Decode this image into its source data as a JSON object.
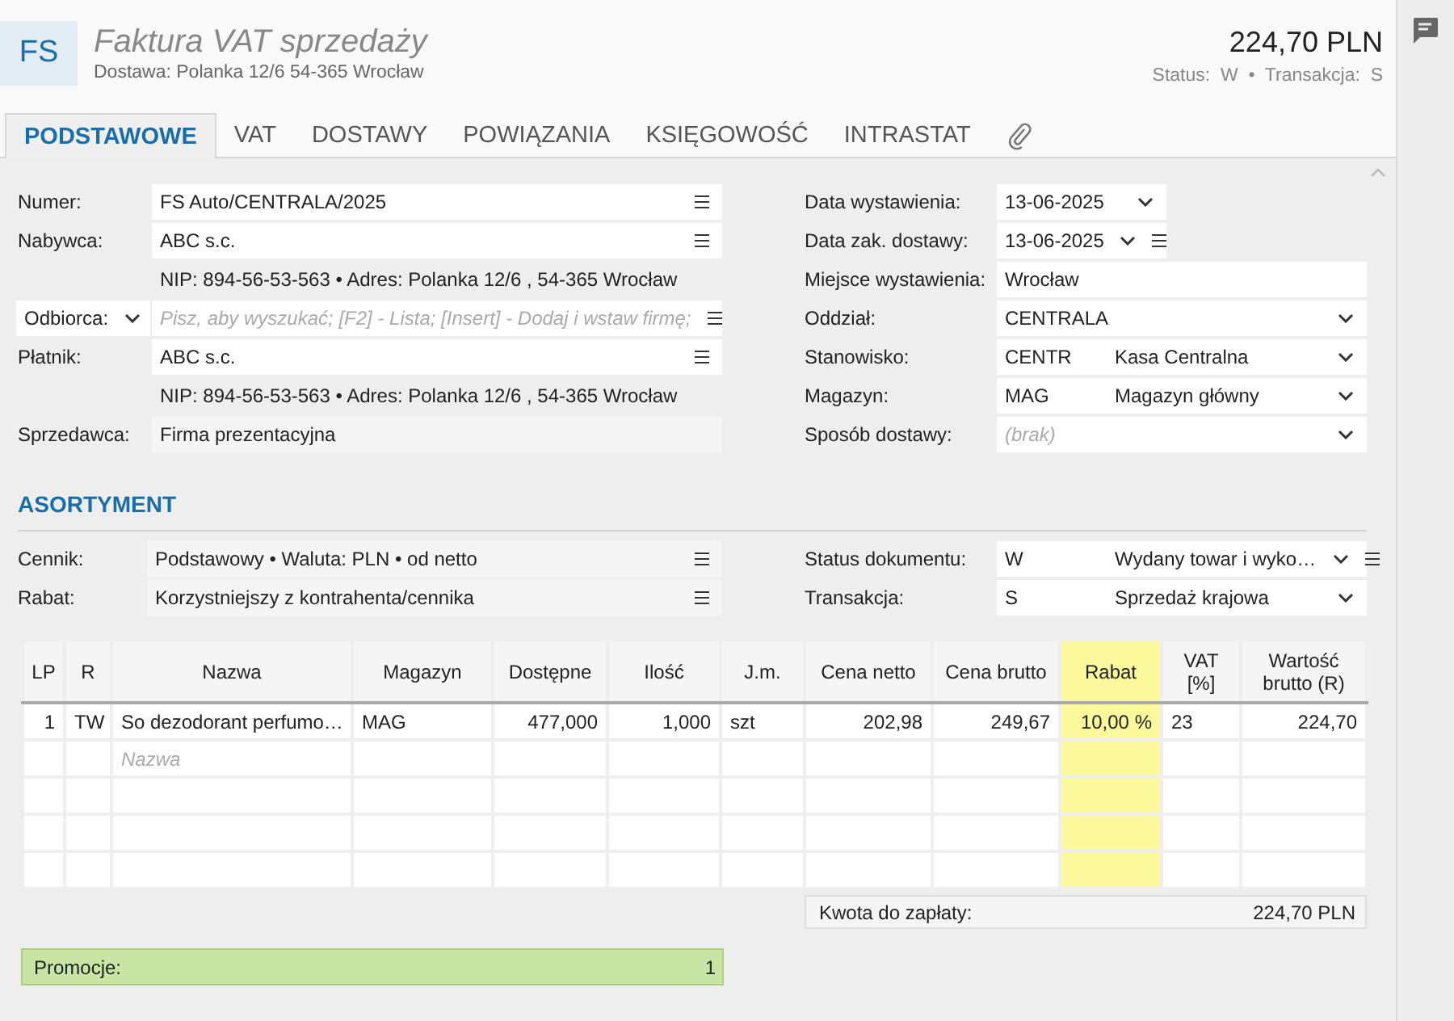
{
  "header": {
    "badge": "FS",
    "title": "Faktura VAT sprzedaży",
    "subtitle": "Dostawa: Polanka  12/6  54-365 Wrocław",
    "amount": "224,70 PLN",
    "status_line": "Status:  W  •  Transakcja:  S"
  },
  "tabs": [
    {
      "kind": "text",
      "label": "PODSTAWOWE",
      "selected": true
    },
    {
      "kind": "text",
      "label": "VAT",
      "selected": false
    },
    {
      "kind": "text",
      "label": "DOSTAWY",
      "selected": false
    },
    {
      "kind": "text",
      "label": "POWIĄZANIA",
      "selected": false
    },
    {
      "kind": "text",
      "label": "KSIĘGOWOŚĆ",
      "selected": false
    },
    {
      "kind": "text",
      "label": "INTRASTAT",
      "selected": false
    },
    {
      "kind": "attachments",
      "selected": false
    }
  ],
  "left_fields": [
    {
      "kind": "field",
      "label": "Numer:",
      "value": "FS Auto/CENTRALA/2025",
      "menu": true
    },
    {
      "kind": "field",
      "label": "Nabywca:",
      "value": "ABC s.c.",
      "menu": true
    },
    {
      "kind": "info",
      "value": "NIP:  894-56-53-563  •  Adres:  Polanka  12/6 , 54-365 Wrocław"
    },
    {
      "kind": "choice",
      "label": "Odbiorca:",
      "placeholder": "Pisz, aby wyszukać; [F2] - Lista; [Insert] - Dodaj i wstaw firmę;",
      "menu": true
    },
    {
      "kind": "field",
      "label": "Płatnik:",
      "value": "ABC s.c.",
      "menu": true
    },
    {
      "kind": "info",
      "value": "NIP:  894-56-53-563  •  Adres:  Polanka  12/6 , 54-365 Wrocław"
    },
    {
      "kind": "readonly",
      "label": "Sprzedawca:",
      "value": "Firma prezentacyjna",
      "menu": false
    }
  ],
  "right_fields": [
    {
      "kind": "date",
      "label": "Data wystawienia:",
      "value": "13-06-2025",
      "menu": false
    },
    {
      "kind": "date",
      "label": "Data zak. dostawy:",
      "value": "13-06-2025",
      "menu": true
    },
    {
      "kind": "text",
      "label": "Miejsce wystawienia:",
      "value": "Wrocław",
      "menu": false
    },
    {
      "kind": "select",
      "label": "Oddział:",
      "value": "CENTRALA",
      "menu": false
    },
    {
      "kind": "select",
      "label": "Stanowisko:",
      "code": "CENTR",
      "value": "Kasa Centralna",
      "menu": false
    },
    {
      "kind": "select",
      "label": "Magazyn:",
      "code": "MAG",
      "value": "Magazyn główny",
      "menu": false
    },
    {
      "kind": "select",
      "label": "Sposób dostawy:",
      "placeholder": "(brak)",
      "menu": false
    }
  ],
  "assortment": {
    "heading": "ASORTYMENT",
    "left_fields": [
      {
        "kind": "readonly",
        "label": "Cennik:",
        "value": "Podstawowy • Waluta: PLN • od netto",
        "menu": true
      },
      {
        "kind": "readonly",
        "label": "Rabat:",
        "value": "Korzystniejszy z kontrahenta/cennika",
        "menu": true
      }
    ],
    "right_fields": [
      {
        "kind": "select",
        "label": "Status dokumentu:",
        "code": "W",
        "value": "Wydany towar i wyko…",
        "menu": true
      },
      {
        "kind": "select",
        "label": "Transakcja:",
        "code": "S",
        "value": "Sprzedaż krajowa",
        "menu": false
      }
    ]
  },
  "table": {
    "columns": [
      {
        "label": "LP",
        "kind": "number",
        "highlighted": false
      },
      {
        "label": "R",
        "kind": "center",
        "highlighted": false
      },
      {
        "label": "Nazwa",
        "kind": "text",
        "highlighted": false
      },
      {
        "label": "Magazyn",
        "kind": "text",
        "highlighted": false
      },
      {
        "label": "Dostępne",
        "kind": "number",
        "highlighted": false
      },
      {
        "label": "Ilość",
        "kind": "number",
        "highlighted": false
      },
      {
        "label": "J.m.",
        "kind": "text",
        "highlighted": false
      },
      {
        "label": "Cena netto",
        "kind": "number",
        "highlighted": false
      },
      {
        "label": "Cena brutto",
        "kind": "number",
        "highlighted": false
      },
      {
        "label": "Rabat",
        "kind": "number",
        "highlighted": true
      },
      {
        "label": "VAT [%]",
        "kind": "text",
        "highlighted": false
      },
      {
        "label": "Wartość brutto (R)",
        "kind": "number",
        "highlighted": false
      }
    ],
    "rows": [
      {
        "cells": [
          "1",
          "TW",
          "So dezodorant perfumo…",
          "MAG",
          "477,000",
          "1,000",
          "szt",
          "202,98",
          "249,67",
          "10,00 %",
          "23",
          "224,70"
        ]
      }
    ],
    "new_row": {
      "placeholder": "Nazwa"
    }
  },
  "total": {
    "label": "Kwota do zapłaty:",
    "value": "224,70 PLN"
  },
  "promotions": {
    "label": "Promocje:",
    "value": "1"
  }
}
